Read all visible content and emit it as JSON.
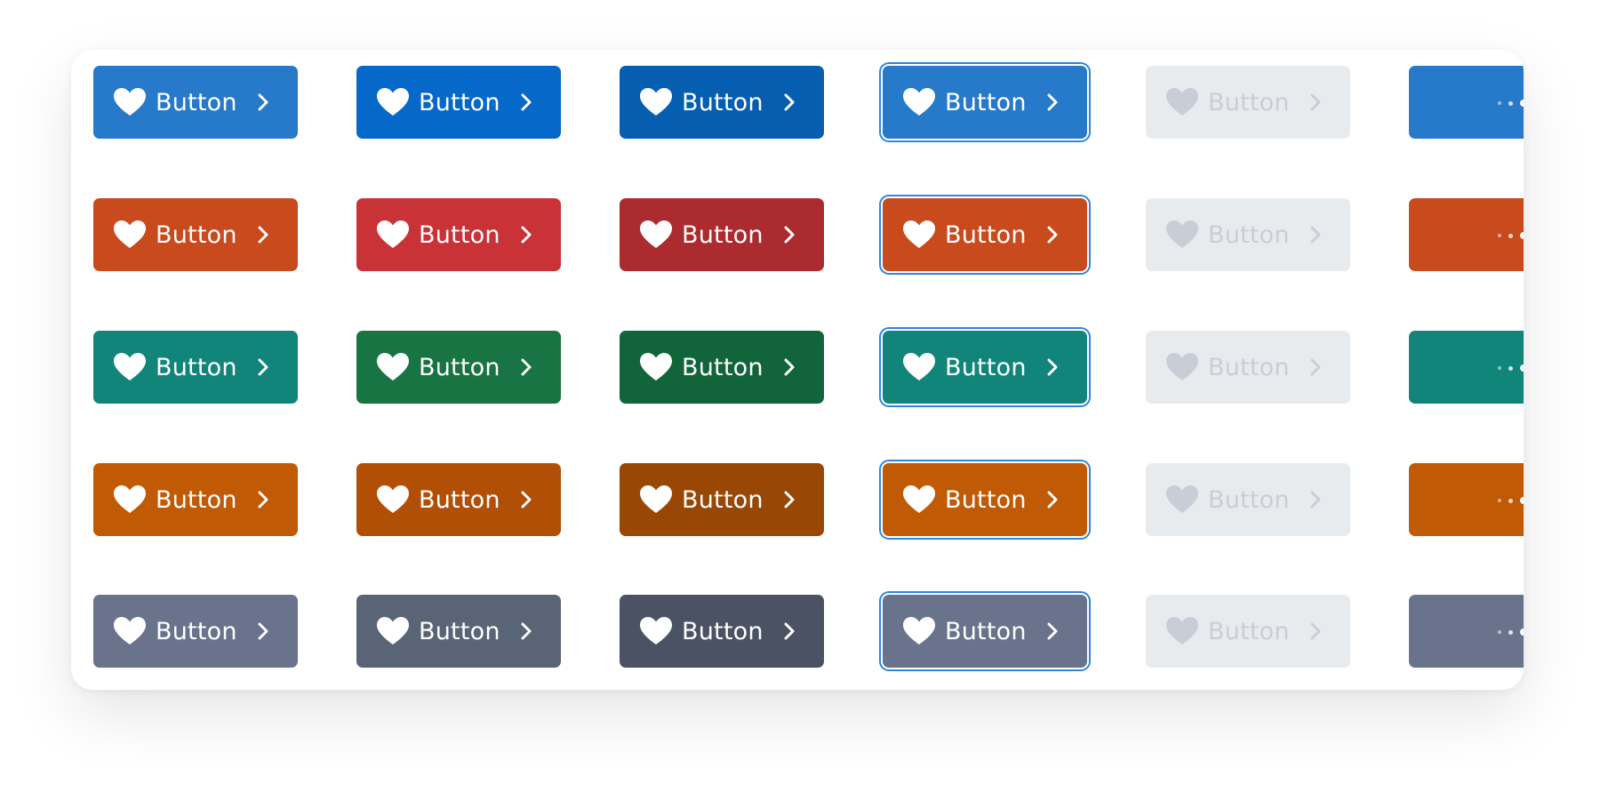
{
  "button_label": "Button",
  "icons": {
    "leading": "heart-icon",
    "trailing": "chevron-right-icon",
    "loading": "loading-dots-icon"
  },
  "rows": [
    {
      "name": "blue",
      "colors": [
        "#2779c9",
        "#0668c8",
        "#065eb1",
        "#2779c9",
        "#e8ebee",
        "#2779c9"
      ]
    },
    {
      "name": "orange-red",
      "colors": [
        "#c94b1d",
        "#c93237",
        "#ac2b2f",
        "#c94b1d",
        "#e8ebee",
        "#c94b1d"
      ]
    },
    {
      "name": "teal",
      "colors": [
        "#12857a",
        "#187442",
        "#12653a",
        "#12857a",
        "#e8ebee",
        "#12857a"
      ]
    },
    {
      "name": "orange",
      "colors": [
        "#c15a04",
        "#b04f05",
        "#984705",
        "#c15a04",
        "#e8ebee",
        "#c15a04"
      ]
    },
    {
      "name": "gray",
      "colors": [
        "#69748c",
        "#5a6477",
        "#4b5263",
        "#69748c",
        "#e8ebee",
        "#69748c"
      ]
    }
  ],
  "states": [
    "default",
    "hover",
    "active",
    "focused",
    "disabled",
    "loading"
  ]
}
